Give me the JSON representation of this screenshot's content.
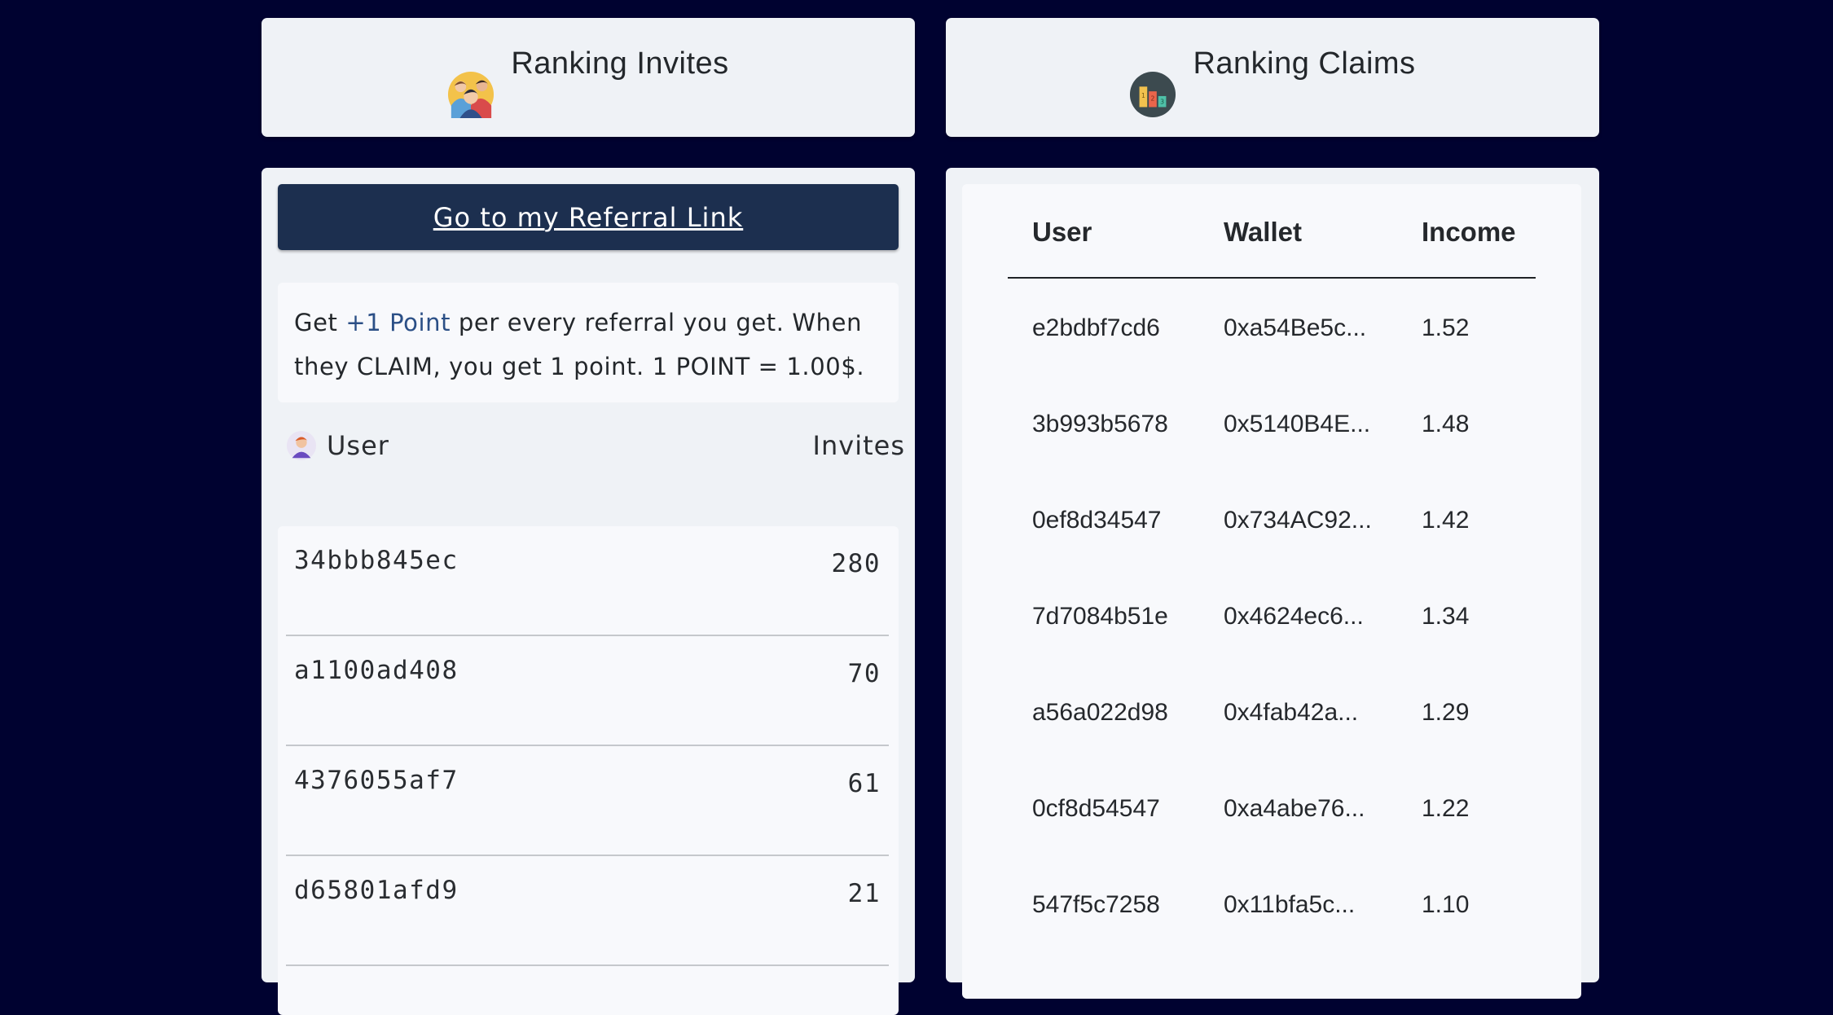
{
  "invites_panel": {
    "title": "Ranking Invites",
    "icon": "group-users-icon",
    "referral_button": "Go to my Referral Link",
    "info": {
      "prefix": "Get ",
      "highlight": "+1 Point",
      "suffix": " per every referral you get. When they CLAIM, you get 1 point. 1 POINT = 1.00$."
    },
    "columns": {
      "user": "User",
      "invites": "Invites"
    },
    "rows": [
      {
        "user": "34bbb845ec",
        "invites": "280"
      },
      {
        "user": "a1100ad408",
        "invites": "70"
      },
      {
        "user": "4376055af7",
        "invites": "61"
      },
      {
        "user": "d65801afd9",
        "invites": "21"
      }
    ]
  },
  "claims_panel": {
    "title": "Ranking Claims",
    "icon": "bar-chart-podium-icon",
    "columns": {
      "user": "User",
      "wallet": "Wallet",
      "income": "Income"
    },
    "rows": [
      {
        "user": "e2bdbf7cd6",
        "wallet": "0xa54Be5c...",
        "income": "1.52"
      },
      {
        "user": "3b993b5678",
        "wallet": "0x5140B4E...",
        "income": "1.48"
      },
      {
        "user": "0ef8d34547",
        "wallet": "0x734AC92...",
        "income": "1.42"
      },
      {
        "user": "7d7084b51e",
        "wallet": "0x4624ec6...",
        "income": "1.34"
      },
      {
        "user": "a56a022d98",
        "wallet": "0x4fab42a...",
        "income": "1.29"
      },
      {
        "user": "0cf8d54547",
        "wallet": "0xa4abe76...",
        "income": "1.22"
      },
      {
        "user": "547f5c7258",
        "wallet": "0x11bfa5c...",
        "income": "1.10"
      }
    ]
  },
  "colors": {
    "page_background": "#000230",
    "card_background": "#eff2f6",
    "button_background": "#1c2f4f",
    "highlight_text": "#2b4f86"
  }
}
